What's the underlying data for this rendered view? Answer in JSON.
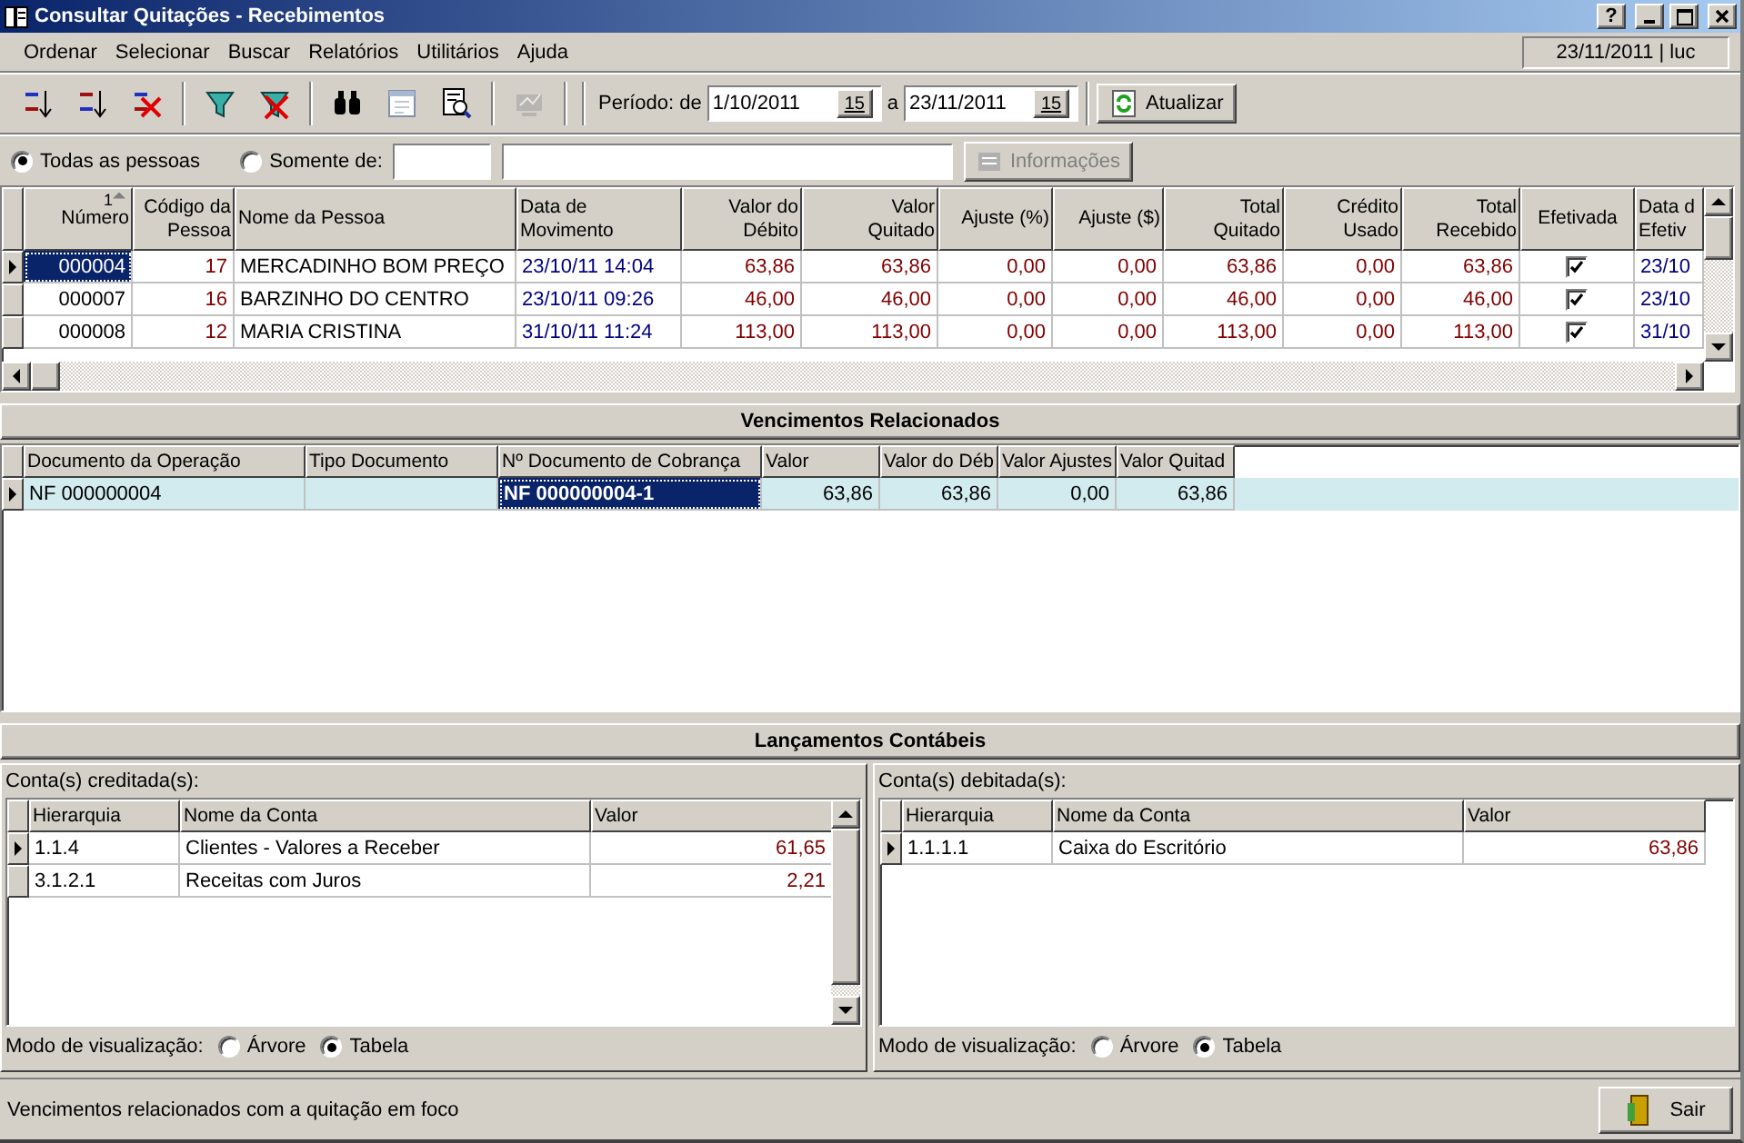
{
  "window": {
    "title": "Consultar Quitações - Recebimentos",
    "help_button": "?"
  },
  "menu": [
    "Ordenar",
    "Selecionar",
    "Buscar",
    "Relatórios",
    "Utilitários",
    "Ajuda"
  ],
  "session": "23/11/2011 | luc",
  "tools": [
    {
      "kind": "sort-asc",
      "disabled": false
    },
    {
      "kind": "sort-desc",
      "disabled": false
    },
    {
      "kind": "sort-clear",
      "disabled": false
    },
    {
      "kind": "filter",
      "disabled": false
    },
    {
      "kind": "filter-clear",
      "disabled": false
    },
    {
      "kind": "search",
      "disabled": false
    },
    {
      "kind": "calendar",
      "disabled": false
    },
    {
      "kind": "preview",
      "disabled": false
    },
    {
      "kind": "sign",
      "disabled": true
    }
  ],
  "period": {
    "label": "Período: de",
    "from": {
      "value": "1/10/2011",
      "button": "15"
    },
    "separator": "a",
    "to": {
      "value": "23/11/2011",
      "button": "15"
    },
    "refresh_button": "Atualizar"
  },
  "filter": {
    "options": [
      {
        "label": "Todas as pessoas",
        "selected": true
      },
      {
        "label": "Somente de:",
        "selected": false
      }
    ],
    "info_button": {
      "label": "Informações",
      "disabled": true
    }
  },
  "main_table": {
    "columns": [
      {
        "label": "Número",
        "kind": "id",
        "sort": "1"
      },
      {
        "label": "Código da\nPessoa",
        "kind": "number"
      },
      {
        "label": "Nome da Pessoa",
        "kind": "text"
      },
      {
        "label": "Data de\nMovimento",
        "kind": "date"
      },
      {
        "label": "Valor do\nDébito",
        "kind": "number"
      },
      {
        "label": "Valor\nQuitado",
        "kind": "number"
      },
      {
        "label": "Ajuste (%)",
        "kind": "number"
      },
      {
        "label": "Ajuste ($)",
        "kind": "number"
      },
      {
        "label": "Total\nQuitado",
        "kind": "number"
      },
      {
        "label": "Crédito\nUsado",
        "kind": "number"
      },
      {
        "label": "Total\nRecebido",
        "kind": "number"
      },
      {
        "label": "Efetivada",
        "kind": "check"
      },
      {
        "label": "Data d\nEfetiv",
        "kind": "date"
      }
    ],
    "rows": [
      {
        "selected": true,
        "efetivada": true,
        "cells": [
          "000004",
          "17",
          "MERCADINHO BOM PREÇO",
          "23/10/11 14:04",
          "63,86",
          "63,86",
          "0,00",
          "0,00",
          "63,86",
          "0,00",
          "63,86",
          "23/10"
        ]
      },
      {
        "selected": false,
        "efetivada": true,
        "cells": [
          "000007",
          "16",
          "BARZINHO DO CENTRO",
          "23/10/11 09:26",
          "46,00",
          "46,00",
          "0,00",
          "0,00",
          "46,00",
          "0,00",
          "46,00",
          "23/10"
        ]
      },
      {
        "selected": false,
        "efetivada": true,
        "cells": [
          "000008",
          "12",
          "MARIA CRISTINA",
          "31/10/11 11:24",
          "113,00",
          "113,00",
          "0,00",
          "0,00",
          "113,00",
          "0,00",
          "113,00",
          "31/10"
        ]
      }
    ]
  },
  "related": {
    "title": "Vencimentos Relacionados",
    "columns": [
      {
        "label": "Documento da Operação",
        "kind": "text"
      },
      {
        "label": "Tipo Documento",
        "kind": "text"
      },
      {
        "label": "Nº Documento de Cobrança",
        "kind": "text"
      },
      {
        "label": "Valor",
        "kind": "plain"
      },
      {
        "label": "Valor do Déb",
        "kind": "plain"
      },
      {
        "label": "Valor Ajustes",
        "kind": "plain"
      },
      {
        "label": "Valor Quitad",
        "kind": "plain"
      }
    ],
    "rows": [
      {
        "selected": true,
        "cells": [
          {
            "text": "NF 000000004",
            "focused": false
          },
          {
            "text": "",
            "focused": false
          },
          {
            "text": "NF 000000004-1",
            "focused": true
          },
          {
            "text": "63,86",
            "focused": false
          },
          {
            "text": "63,86",
            "focused": false
          },
          {
            "text": "0,00",
            "focused": false
          },
          {
            "text": "63,86",
            "focused": false
          }
        ]
      }
    ]
  },
  "accounting": {
    "title": "Lançamentos Contábeis",
    "panels": [
      {
        "label": "Conta(s) creditada(s):",
        "scrollbar": true,
        "columns": [
          {
            "label": "Hierarquia",
            "kind": "text"
          },
          {
            "label": "Nome da Conta",
            "kind": "text"
          },
          {
            "label": "Valor",
            "kind": "number"
          }
        ],
        "rows": [
          {
            "selected": true,
            "cells": [
              "1.1.4",
              "Clientes - Valores a Receber",
              "61,65"
            ]
          },
          {
            "selected": false,
            "cells": [
              "3.1.2.1",
              "Receitas com Juros",
              "2,21"
            ]
          }
        ],
        "view_label": "Modo de visualização:",
        "view_options": [
          {
            "label": "Árvore",
            "selected": false
          },
          {
            "label": "Tabela",
            "selected": true
          }
        ]
      },
      {
        "label": "Conta(s) debitada(s):",
        "scrollbar": false,
        "columns": [
          {
            "label": "Hierarquia",
            "kind": "text"
          },
          {
            "label": "Nome da Conta",
            "kind": "text"
          },
          {
            "label": "Valor",
            "kind": "number"
          }
        ],
        "rows": [
          {
            "selected": true,
            "cells": [
              "1.1.1.1",
              "Caixa do Escritório",
              "63,86"
            ]
          }
        ],
        "view_label": "Modo de visualização:",
        "view_options": [
          {
            "label": "Árvore",
            "selected": false
          },
          {
            "label": "Tabela",
            "selected": true
          }
        ]
      }
    ]
  },
  "status_bar": {
    "text": "Vencimentos relacionados com a quitação em foco",
    "exit_button": "Sair"
  }
}
